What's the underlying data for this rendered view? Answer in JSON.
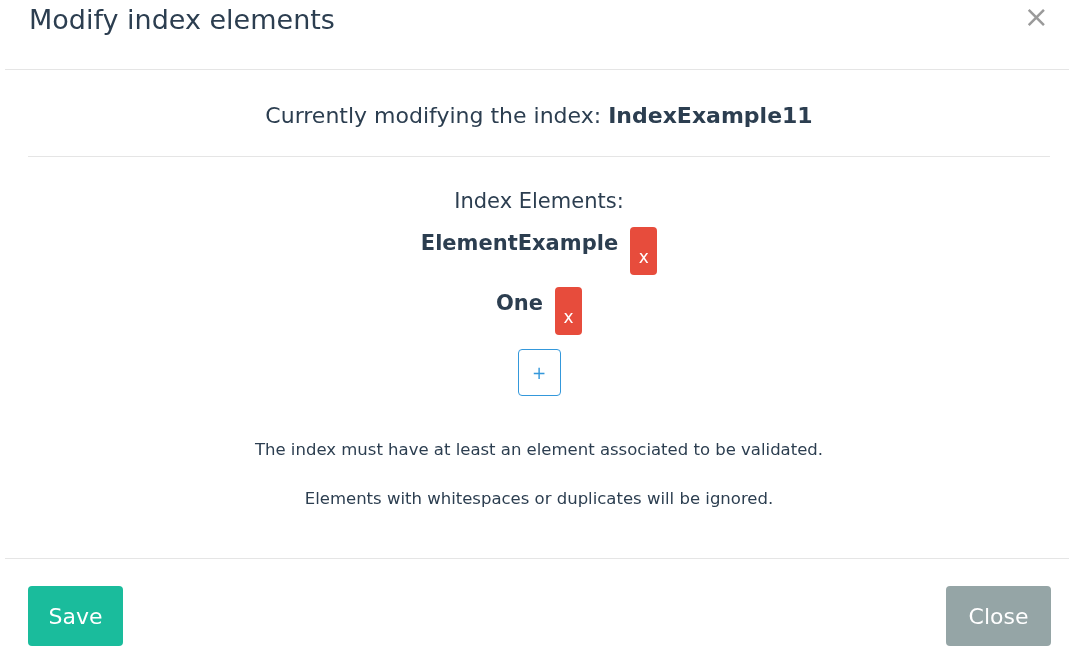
{
  "dialog": {
    "title": "Modify index elements",
    "close_icon": "×"
  },
  "current": "Currently modifying the index: **IndexExample11**",
  "elements_heading": "Index Elements:",
  "elements": [
    {
      "name": "ElementExample",
      "remove": "x"
    },
    {
      "name": "One",
      "remove": "x"
    }
  ],
  "add_button": "+",
  "notes": [
    "The index must have at least an element associated to be validated.",
    "Elements with whitespaces or duplicates will be ignored."
  ],
  "footer": {
    "save": "Save",
    "close": "Close"
  }
}
